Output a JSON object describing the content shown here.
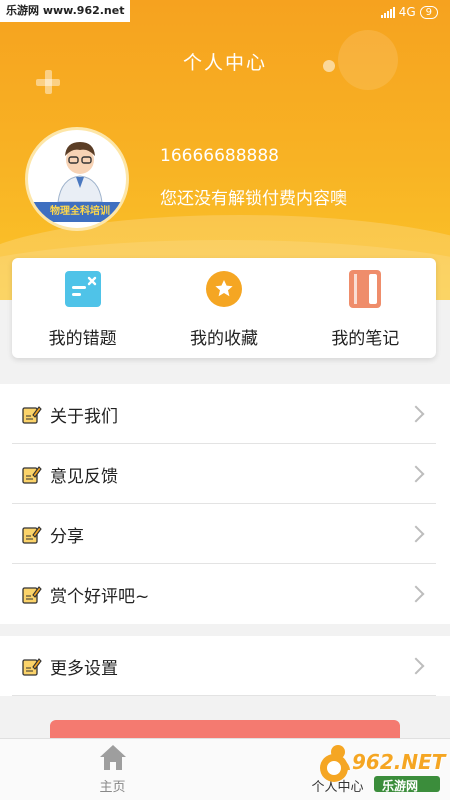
{
  "watermark": "乐游网 www.962.net",
  "status": {
    "network": "4G",
    "battery": "9"
  },
  "header": {
    "title": "个人中心",
    "phone": "16666688888",
    "tip": "您还没有解锁付费内容噢",
    "avatar_banner": "物理全科培训"
  },
  "shortcuts": [
    {
      "label": "我的错题",
      "icon": "wrong-questions-icon",
      "color": "#4fc3e8"
    },
    {
      "label": "我的收藏",
      "icon": "star-icon",
      "color": "#f5a623"
    },
    {
      "label": "我的笔记",
      "icon": "notebook-icon",
      "color": "#ef8d6b"
    }
  ],
  "menu": [
    {
      "label": "关于我们"
    },
    {
      "label": "意见反馈"
    },
    {
      "label": "分享"
    },
    {
      "label": "赏个好评吧~"
    }
  ],
  "menu2": [
    {
      "label": "更多设置"
    }
  ],
  "tabs": [
    {
      "label": "主页",
      "active": false
    },
    {
      "label": "个人中心",
      "active": true
    }
  ],
  "brand": {
    "logo_text": "962.NET",
    "sub_text": "乐游网"
  },
  "colors": {
    "accent": "#f8b324",
    "active_tab": "#f5a623",
    "inactive_tab": "#888888"
  }
}
